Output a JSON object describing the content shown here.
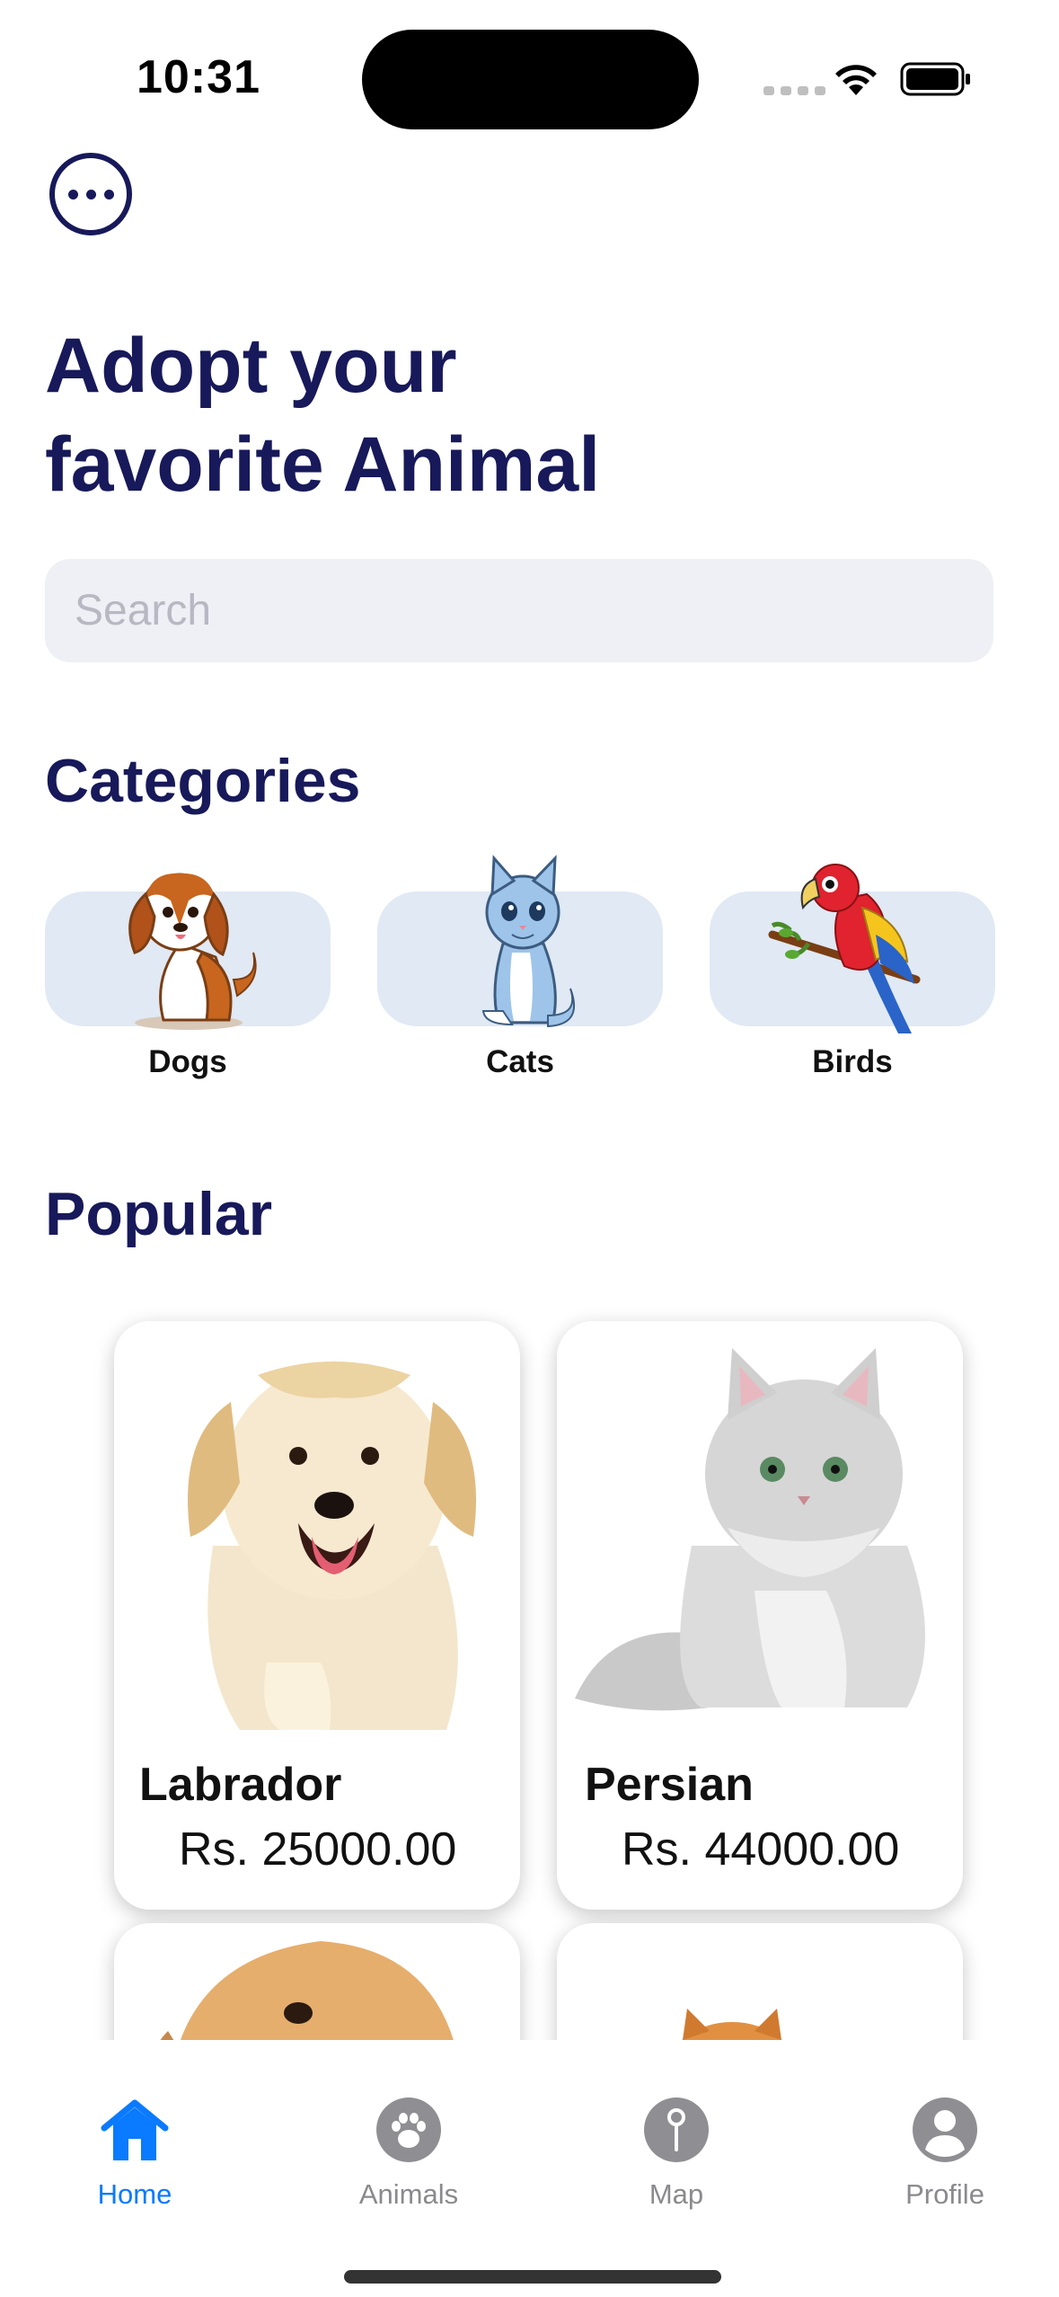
{
  "status_bar": {
    "time": "10:31"
  },
  "header": {
    "title_line1": "Adopt your",
    "title_line2": "favorite Animal"
  },
  "search": {
    "placeholder": "Search",
    "value": ""
  },
  "categories": {
    "title": "Categories",
    "items": [
      {
        "label": "Dogs",
        "icon": "dog-icon"
      },
      {
        "label": "Cats",
        "icon": "cat-icon"
      },
      {
        "label": "Birds",
        "icon": "parrot-icon"
      }
    ]
  },
  "popular": {
    "title": "Popular",
    "items": [
      {
        "name": "Labrador",
        "price": "Rs. 25000.00"
      },
      {
        "name": "Persian",
        "price": "Rs. 44000.00"
      }
    ]
  },
  "tabs": [
    {
      "label": "Home",
      "icon": "house-icon",
      "active": true
    },
    {
      "label": "Animals",
      "icon": "paw-icon",
      "active": false
    },
    {
      "label": "Map",
      "icon": "map-pin-icon",
      "active": false
    },
    {
      "label": "Profile",
      "icon": "person-icon",
      "active": false
    }
  ],
  "colors": {
    "navy": "#17195a",
    "accent": "#0a7aff",
    "category_bg": "#e0e9f4",
    "search_bg": "#eff0f5"
  }
}
